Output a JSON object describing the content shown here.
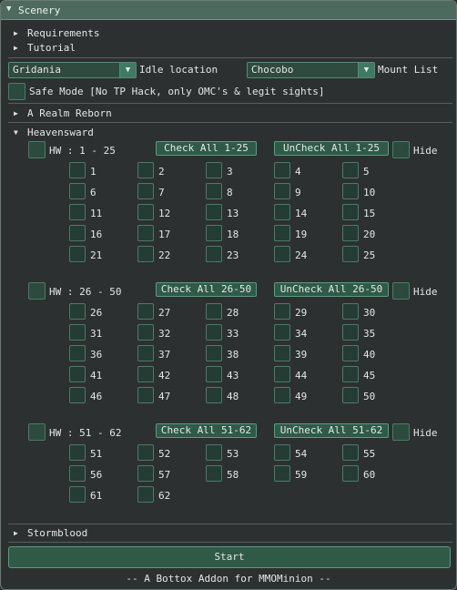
{
  "window": {
    "title": "Scenery"
  },
  "nodes": {
    "requirements": "Requirements",
    "tutorial": "Tutorial",
    "a_realm_reborn": "A Realm Reborn",
    "heavensward": "Heavensward",
    "stormblood": "Stormblood"
  },
  "idle": {
    "value": "Gridania",
    "label": "Idle location"
  },
  "mount": {
    "value": "Chocobo",
    "label": "Mount List"
  },
  "safe_mode": "Safe Mode [No TP Hack, only OMC's & legit sights]",
  "groups": [
    {
      "label": "HW : 1 - 25",
      "check_all": "Check All 1-25",
      "uncheck_all": "UnCheck All 1-25",
      "hide": "Hide",
      "items": [
        "1",
        "2",
        "3",
        "4",
        "5",
        "6",
        "7",
        "8",
        "9",
        "10",
        "11",
        "12",
        "13",
        "14",
        "15",
        "16",
        "17",
        "18",
        "19",
        "20",
        "21",
        "22",
        "23",
        "24",
        "25"
      ]
    },
    {
      "label": "HW : 26 - 50",
      "check_all": "Check All 26-50",
      "uncheck_all": "UnCheck All 26-50",
      "hide": "Hide",
      "items": [
        "26",
        "27",
        "28",
        "29",
        "30",
        "31",
        "32",
        "33",
        "34",
        "35",
        "36",
        "37",
        "38",
        "39",
        "40",
        "41",
        "42",
        "43",
        "44",
        "45",
        "46",
        "47",
        "48",
        "49",
        "50"
      ]
    },
    {
      "label": "HW : 51 - 62",
      "check_all": "Check All 51-62",
      "uncheck_all": "UnCheck All 51-62",
      "hide": "Hide",
      "items": [
        "51",
        "52",
        "53",
        "54",
        "55",
        "56",
        "57",
        "58",
        "59",
        "60",
        "61",
        "62"
      ]
    }
  ],
  "start_label": "Start",
  "footer": "-- A Bottox Addon for MMOMinion --",
  "colors": {
    "titlebar": "#4e6a5e",
    "accent": "#2f5a48",
    "checkbox": "#243c33",
    "background": "#2c3030"
  },
  "icons": {
    "expanded": "triangle-down-icon",
    "collapsed": "triangle-right-icon",
    "dropdown": "dropdown-arrow-icon"
  }
}
